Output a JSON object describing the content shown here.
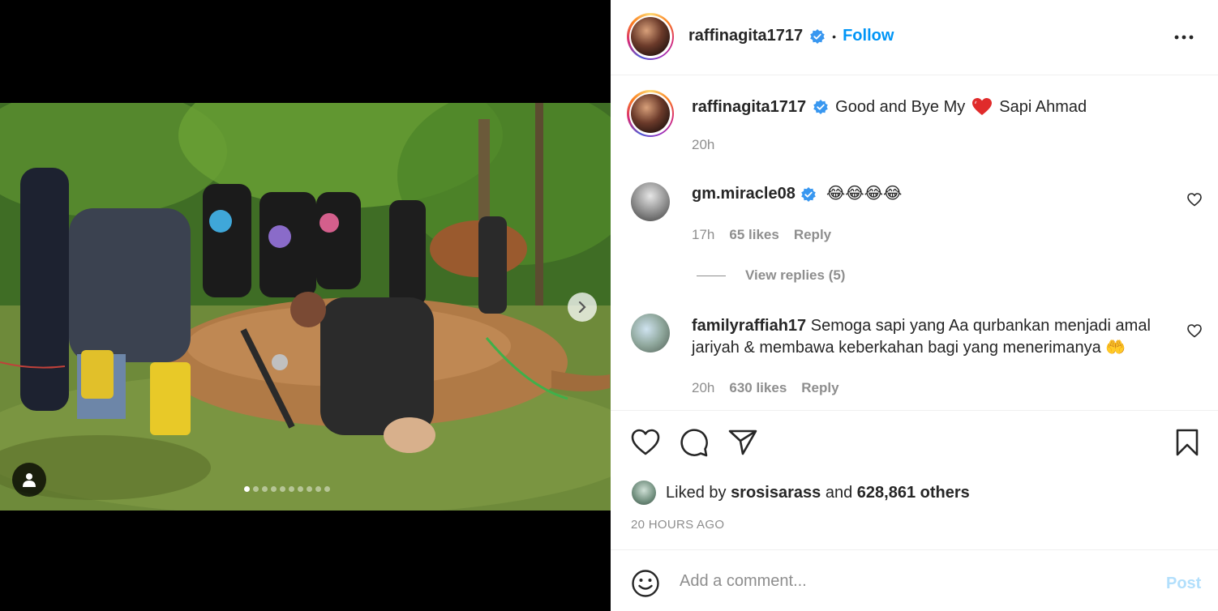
{
  "post": {
    "author": "raffinagita1717",
    "follow_label": "Follow",
    "separator": "•",
    "caption_text": "Good and Bye My",
    "caption_tail": "Sapi Ahmad",
    "caption_time": "20h"
  },
  "media": {
    "slide_count": 10,
    "active_slide": 0
  },
  "comments": [
    {
      "username": "gm.miracle08",
      "verified": true,
      "text": "😂😂😂😂",
      "time": "17h",
      "likes": "65 likes",
      "reply_label": "Reply",
      "view_replies": "View replies (5)"
    },
    {
      "username": "familyraffiah17",
      "verified": false,
      "text_line1": "Semoga sapi yang Aa qurbankan menjadi amal",
      "text_line2": "jariyah & membawa keberkahan bagi yang menerimanya 🤲",
      "time": "20h",
      "likes": "630 likes",
      "reply_label": "Reply"
    }
  ],
  "likes": {
    "prefix": "Liked by",
    "user": "srosisarass",
    "joiner": "and",
    "others": "628,861 others"
  },
  "timestamp": "20 HOURS AGO",
  "composer": {
    "placeholder": "Add a comment...",
    "post_label": "Post"
  },
  "colors": {
    "accent": "#0095f6",
    "verified": "#3897f0",
    "muted": "#8e8e8e",
    "heart_red": "#ed4956"
  }
}
